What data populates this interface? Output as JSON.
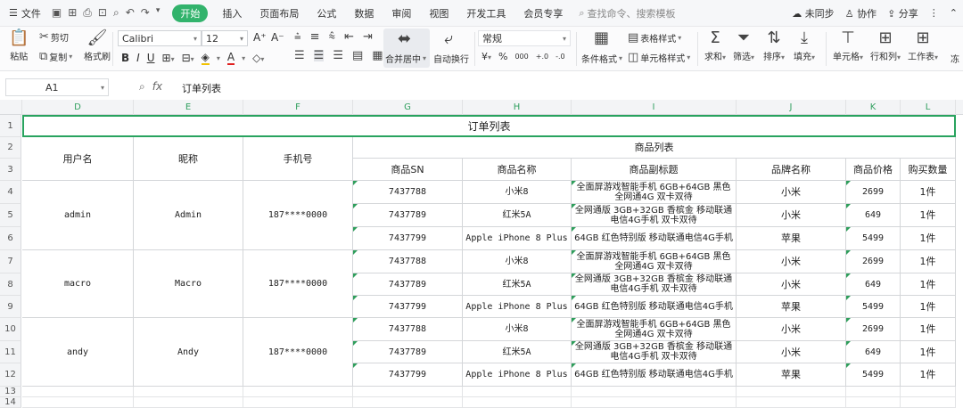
{
  "menu": {
    "file": "文件",
    "tabs": [
      "开始",
      "插入",
      "页面布局",
      "公式",
      "数据",
      "审阅",
      "视图",
      "开发工具",
      "会员专享"
    ],
    "active_tab": "开始",
    "search_placeholder": "查找命令、搜索模板",
    "sync": "未同步",
    "collab": "协作",
    "share": "分享"
  },
  "ribbon": {
    "paste": "粘贴",
    "cut": "剪切",
    "copy": "复制",
    "format_painter": "格式刷",
    "font_name": "Calibri",
    "font_size": "12",
    "merge_center": "合并居中",
    "wrap": "自动换行",
    "number_format": "常规",
    "conditional": "条件格式",
    "table_style": "表格样式",
    "cell_style": "单元格样式",
    "sum": "求和",
    "filter": "筛选",
    "sort": "排序",
    "fill": "填充",
    "cell": "单元格",
    "rowcol": "行和列",
    "worksheet": "工作表",
    "more": "冻"
  },
  "formula_bar": {
    "cell_ref": "A1",
    "fx": "fx",
    "content": "订单列表"
  },
  "columns": [
    "D",
    "E",
    "F",
    "G",
    "H",
    "I",
    "J",
    "K",
    "L"
  ],
  "rows": [
    "1",
    "2",
    "3",
    "4",
    "5",
    "6",
    "7",
    "8",
    "9",
    "10",
    "11",
    "12",
    "13",
    "14"
  ],
  "table": {
    "title": "订单列表",
    "group_header": "商品列表",
    "headers": {
      "username": "用户名",
      "nickname": "昵称",
      "phone": "手机号",
      "sn": "商品SN",
      "name": "商品名称",
      "subtitle": "商品副标题",
      "brand": "品牌名称",
      "price": "商品价格",
      "qty": "购买数量"
    },
    "users": [
      {
        "username": "admin",
        "nickname": "Admin",
        "phone": "187****0000"
      },
      {
        "username": "macro",
        "nickname": "Macro",
        "phone": "187****0000"
      },
      {
        "username": "andy",
        "nickname": "Andy",
        "phone": "187****0000"
      }
    ],
    "products": [
      {
        "sn": "7437788",
        "name": "小米8",
        "subtitle": "全面屏游戏智能手机 6GB+64GB 黑色 全网通4G 双卡双待",
        "brand": "小米",
        "price": "2699",
        "qty": "1件"
      },
      {
        "sn": "7437789",
        "name": "红米5A",
        "subtitle": "全网通版 3GB+32GB 香槟金 移动联通电信4G手机 双卡双待",
        "brand": "小米",
        "price": "649",
        "qty": "1件"
      },
      {
        "sn": "7437799",
        "name": "Apple iPhone 8 Plus",
        "subtitle": "64GB 红色特别版 移动联通电信4G手机",
        "brand": "苹果",
        "price": "5499",
        "qty": "1件"
      },
      {
        "sn": "7437788",
        "name": "小米8",
        "subtitle": "全面屏游戏智能手机 6GB+64GB 黑色 全网通4G 双卡双待",
        "brand": "小米",
        "price": "2699",
        "qty": "1件"
      },
      {
        "sn": "7437789",
        "name": "红米5A",
        "subtitle": "全网通版 3GB+32GB 香槟金 移动联通电信4G手机 双卡双待",
        "brand": "小米",
        "price": "649",
        "qty": "1件"
      },
      {
        "sn": "7437799",
        "name": "Apple iPhone 8 Plus",
        "subtitle": "64GB 红色特别版 移动联通电信4G手机",
        "brand": "苹果",
        "price": "5499",
        "qty": "1件"
      },
      {
        "sn": "7437788",
        "name": "小米8",
        "subtitle": "全面屏游戏智能手机 6GB+64GB 黑色 全网通4G 双卡双待",
        "brand": "小米",
        "price": "2699",
        "qty": "1件"
      },
      {
        "sn": "7437789",
        "name": "红米5A",
        "subtitle": "全网通版 3GB+32GB 香槟金 移动联通电信4G手机 双卡双待",
        "brand": "小米",
        "price": "649",
        "qty": "1件"
      },
      {
        "sn": "7437799",
        "name": "Apple iPhone 8 Plus",
        "subtitle": "64GB 红色特别版 移动联通电信4G手机",
        "brand": "苹果",
        "price": "5499",
        "qty": "1件"
      }
    ]
  },
  "colors": {
    "accent": "#32b36c",
    "selection": "#29a35f"
  }
}
